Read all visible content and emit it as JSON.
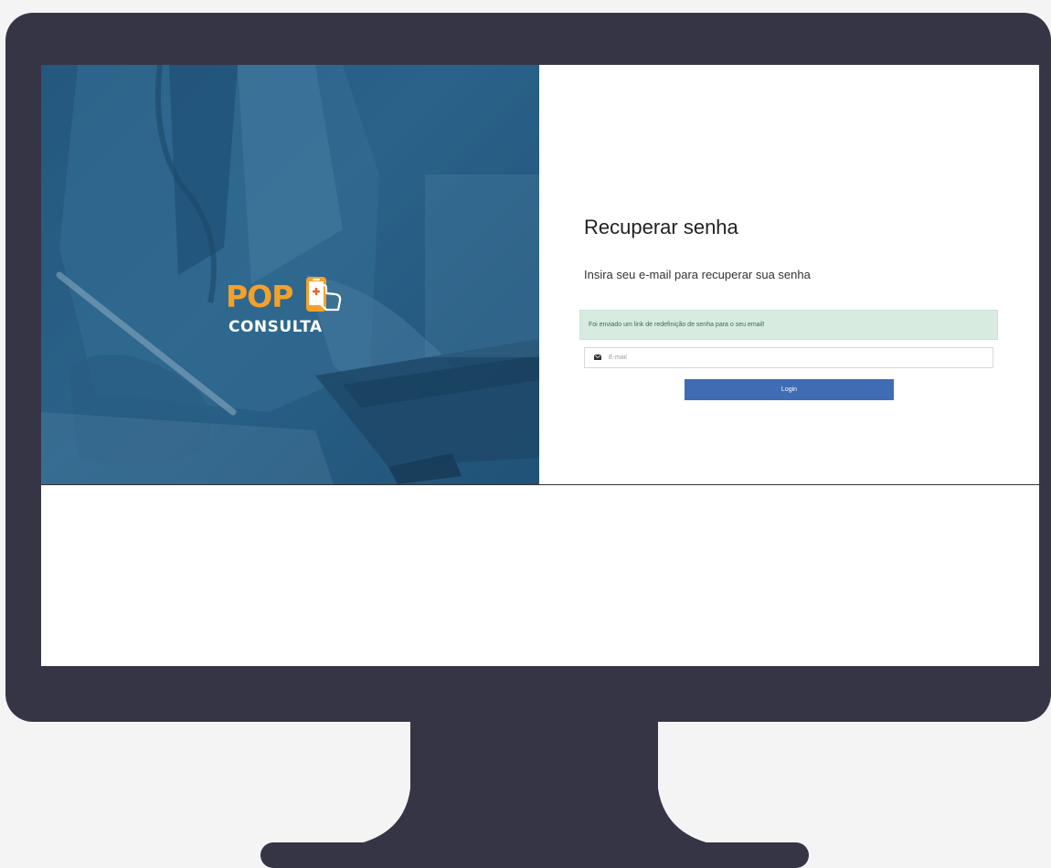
{
  "brand": {
    "line1": "POP",
    "line2": "CONSULTA",
    "colors": {
      "orange": "#f4a12a",
      "white": "#ffffff",
      "hero_overlay": "#2a6189"
    }
  },
  "form": {
    "title": "Recuperar senha",
    "subtitle": "Insira seu e-mail para recuperar sua senha",
    "alert_message": "Foi enviado um link de redefinição de senha para o seu email!",
    "email_placeholder": "E-mail",
    "email_value": "",
    "email_icon": "envelope-icon",
    "submit_label": "Login"
  },
  "colors": {
    "monitor_frame": "#363546",
    "alert_background": "#d7ebe1",
    "button": "#3f6cb3"
  }
}
